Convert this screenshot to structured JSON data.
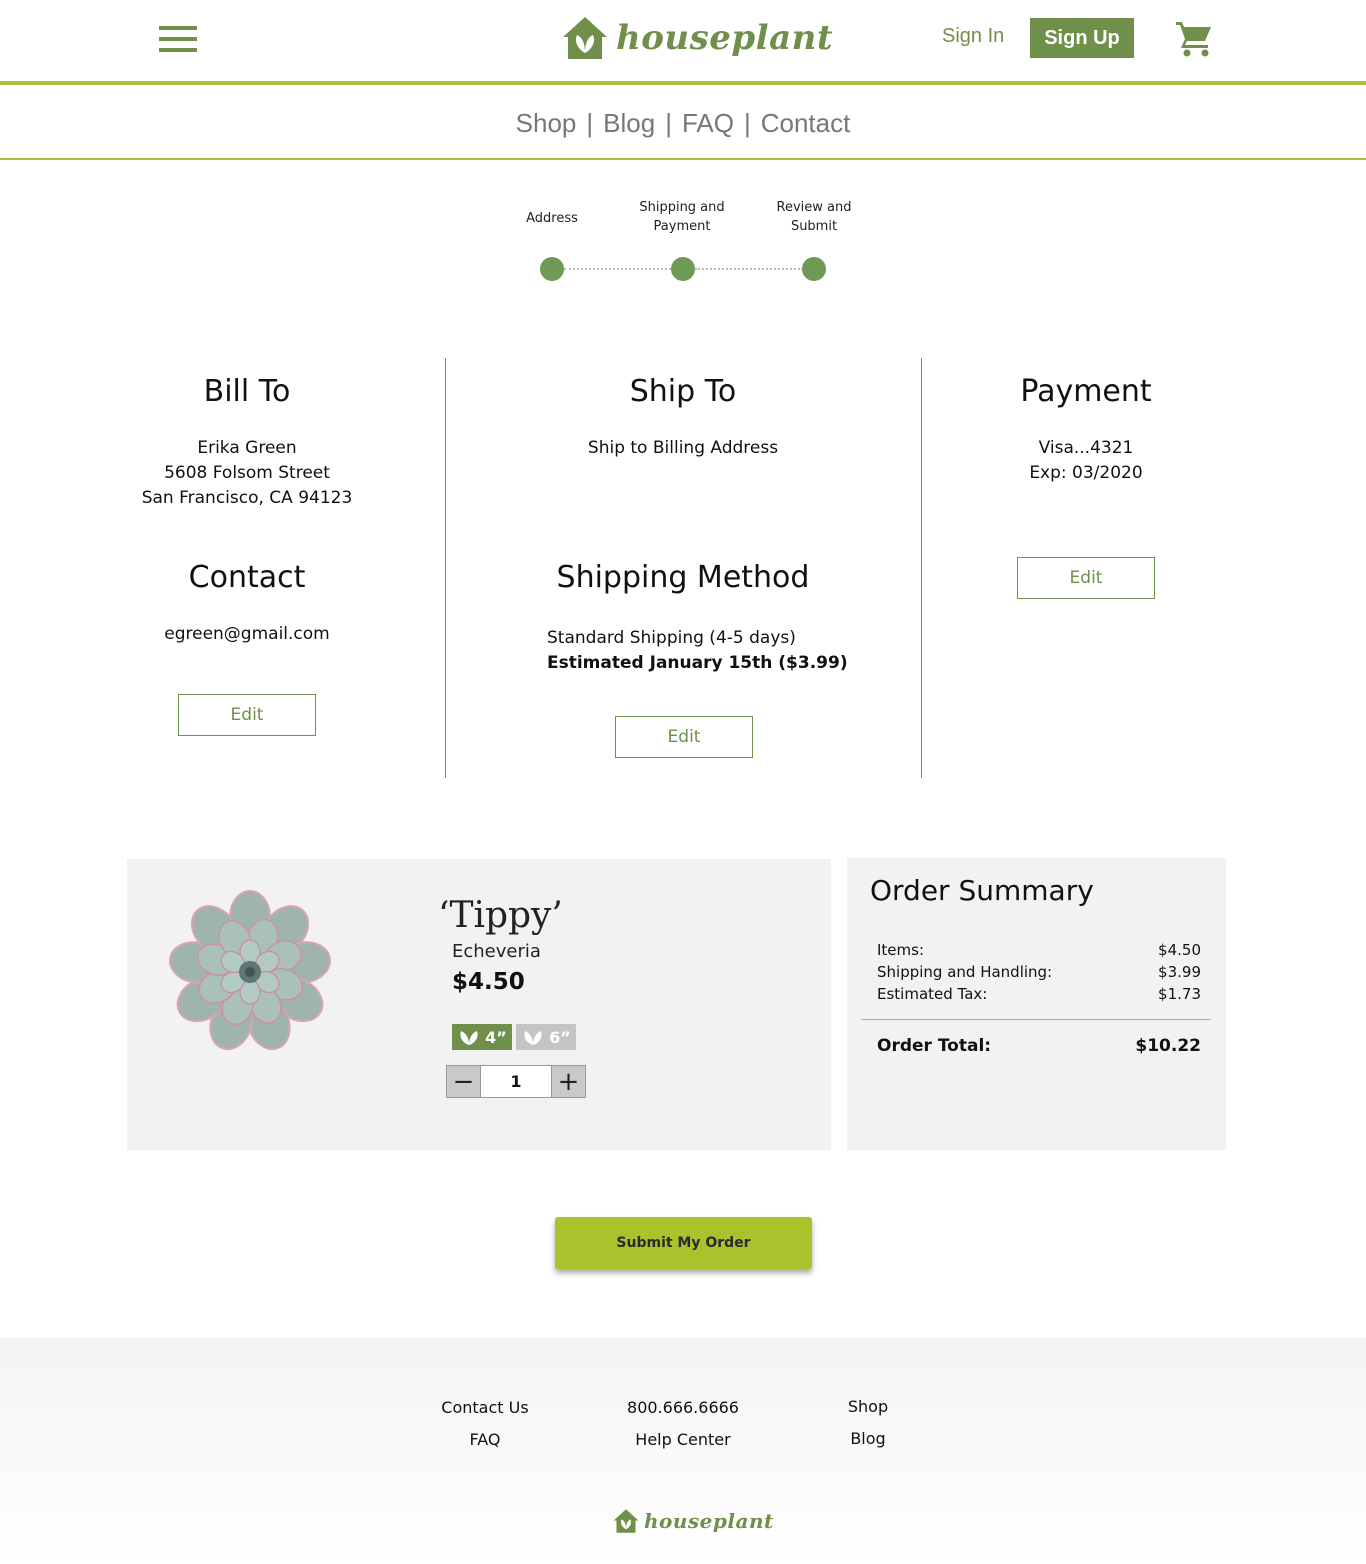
{
  "header": {
    "logo_text": "houseplant",
    "sign_in": "Sign In",
    "sign_up": "Sign Up",
    "accent_color": "#6f8f4a",
    "rule_color": "#a8c13c"
  },
  "nav": {
    "items": [
      "Shop",
      "Blog",
      "FAQ",
      "Contact"
    ],
    "separator": "|"
  },
  "steps": [
    {
      "label": "Address"
    },
    {
      "label": "Shipping and Payment"
    },
    {
      "label": "Review and Submit"
    }
  ],
  "bill_to": {
    "heading": "Bill To",
    "name": "Erika Green",
    "street": "5608 Folsom Street",
    "city": "San Francisco, CA 94123"
  },
  "contact": {
    "heading": "Contact",
    "email": "egreen@gmail.com",
    "edit_label": "Edit"
  },
  "ship_to": {
    "heading": "Ship To",
    "text": "Ship to Billing Address"
  },
  "shipping_method": {
    "heading": "Shipping Method",
    "method": "Standard Shipping (4-5 days)",
    "estimate": "Estimated January 15th ($3.99)",
    "edit_label": "Edit"
  },
  "payment": {
    "heading": "Payment",
    "card": "Visa...4321",
    "exp": "Exp: 03/2020",
    "edit_label": "Edit"
  },
  "product": {
    "name": "‘Tippy’",
    "type": "Echeveria",
    "price": "$4.50",
    "sizes": [
      {
        "label": "4”",
        "selected": true
      },
      {
        "label": "6”",
        "selected": false
      }
    ],
    "quantity": "1",
    "qty_minus": "−",
    "qty_plus": "+"
  },
  "summary": {
    "title": "Order Summary",
    "rows": [
      {
        "label": "Items:",
        "value": "$4.50"
      },
      {
        "label": "Shipping and Handling:",
        "value": "$3.99"
      },
      {
        "label": "Estimated Tax:",
        "value": "$1.73"
      }
    ],
    "total_label": "Order Total:",
    "total_value": "$10.22"
  },
  "submit_label": "Submit My Order",
  "footer": {
    "col1": [
      "Contact Us",
      "FAQ"
    ],
    "col2": [
      "800.666.6666",
      "Help Center"
    ],
    "col3": [
      "Shop",
      "Blog"
    ],
    "logo_text": "houseplant"
  }
}
